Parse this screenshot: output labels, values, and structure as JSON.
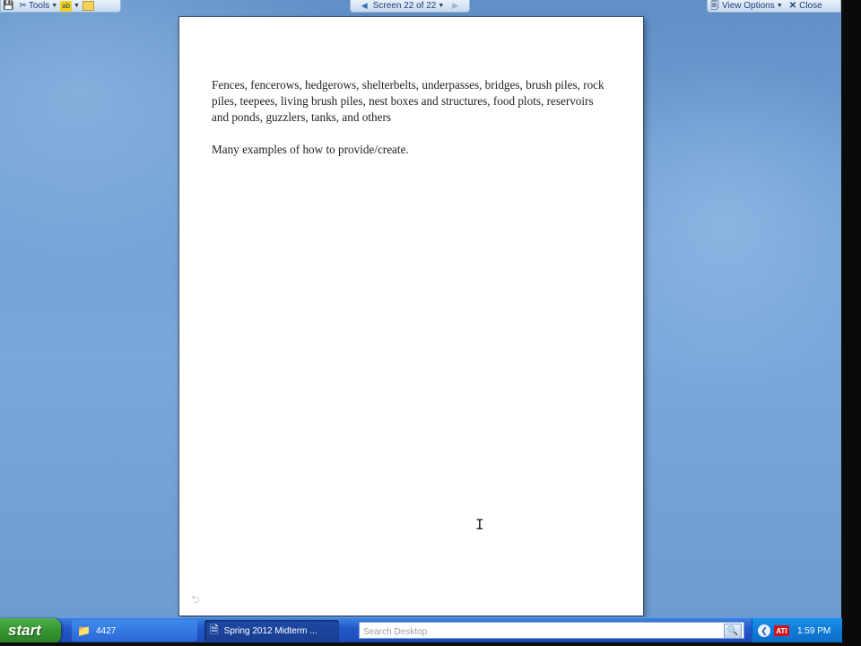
{
  "toolbar": {
    "tools_label": "Tools",
    "screen_label": "Screen 22 of 22",
    "view_options_label": "View Options",
    "close_label": "Close"
  },
  "document": {
    "paragraph1": "Fences, fencerows, hedgerows, shelterbelts, underpasses, bridges, brush piles, rock piles, teepees, living brush piles, nest boxes and structures, food plots, reservoirs and ponds, guzzlers, tanks, and others",
    "paragraph2": "Many examples of how to provide/create."
  },
  "taskbar": {
    "start_label": "start",
    "tasks": [
      {
        "label": "4427",
        "icon": "folder-icon"
      },
      {
        "label": "Spring 2012 Midterm ...",
        "icon": "word-document-icon"
      }
    ],
    "search_placeholder": "Search Desktop",
    "clock": "1:59 PM"
  },
  "colors": {
    "desktop": "#6e9dd2",
    "taskbar": "#2458c8",
    "start_button": "#35962f",
    "tray": "#0f7ad8"
  }
}
